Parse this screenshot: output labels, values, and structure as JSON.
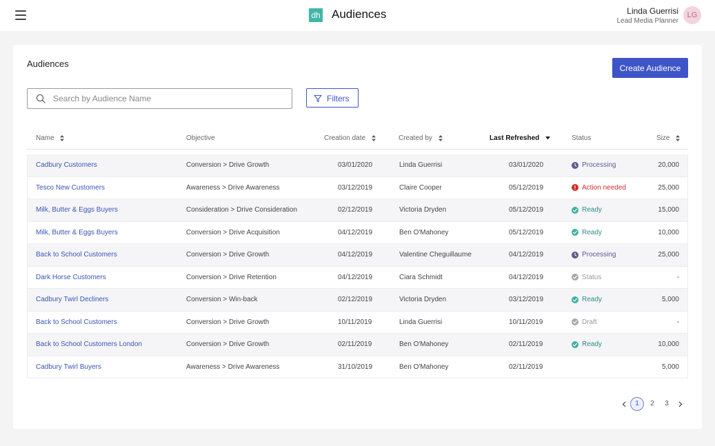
{
  "header": {
    "logo_text": "dh",
    "title": "Audiences",
    "user_name": "Linda Guerrisi",
    "user_role": "Lead Media Planner",
    "user_initials": "LG"
  },
  "page": {
    "title": "Audiences",
    "create_label": "Create Audience",
    "search_placeholder": "Search by Audience Name",
    "search_value": "",
    "filters_label": "Filters"
  },
  "table": {
    "columns": {
      "name": "Name",
      "objective": "Objective",
      "creation_date": "Creation date",
      "created_by": "Created by",
      "last_refreshed": "Last Refreshed",
      "status": "Status",
      "size": "Size"
    },
    "rows": [
      {
        "name": "Cadbury Customers",
        "objective": "Conversion > Drive Growth",
        "creation_date": "03/01/2020",
        "created_by": "Linda Guerrisi",
        "last_refreshed": "03/01/2020",
        "status": "Processing",
        "status_kind": "processing",
        "size": "20,000"
      },
      {
        "name": "Tesco New Customers",
        "objective": "Awareness > Drive Awareness",
        "creation_date": "03/12/2019",
        "created_by": "Claire Cooper",
        "last_refreshed": "05/12/2019",
        "status": "Action needed",
        "status_kind": "action",
        "size": "25,000"
      },
      {
        "name": "Milk, Butter & Eggs Buyers",
        "objective": "Consideration > Drive Consideration",
        "creation_date": "02/12/2019",
        "created_by": "Victoria Dryden",
        "last_refreshed": "05/12/2019",
        "status": "Ready",
        "status_kind": "ready",
        "size": "15,000"
      },
      {
        "name": "Milk, Butter & Eggs Buyers",
        "objective": "Conversion > Drive Acquisition",
        "creation_date": "04/12/2019",
        "created_by": "Ben O'Mahoney",
        "last_refreshed": "05/12/2019",
        "status": "Ready",
        "status_kind": "ready",
        "size": "10,000"
      },
      {
        "name": "Back to School Customers",
        "objective": "Conversion > Drive Growth",
        "creation_date": "04/12/2019",
        "created_by": "Valentine Cheguillaume",
        "last_refreshed": "04/12/2019",
        "status": "Processing",
        "status_kind": "processing",
        "size": "25,000"
      },
      {
        "name": "Dark Horse Customers",
        "objective": "Conversion > Drive Retention",
        "creation_date": "04/12/2019",
        "created_by": "Ciara Schmidt",
        "last_refreshed": "04/12/2019",
        "status": "Status",
        "status_kind": "neutral",
        "size": "-"
      },
      {
        "name": "Cadbury Twirl Decliners",
        "objective": "Conversion > Win-back",
        "creation_date": "02/12/2019",
        "created_by": "Victoria Dryden",
        "last_refreshed": "03/12/2019",
        "status": "Ready",
        "status_kind": "ready",
        "size": "5,000"
      },
      {
        "name": "Back to School Customers",
        "objective": "Conversion > Drive Growth",
        "creation_date": "10/11/2019",
        "created_by": "Linda Guerrisi",
        "last_refreshed": "10/11/2019",
        "status": "Draft",
        "status_kind": "neutral",
        "size": "-"
      },
      {
        "name": "Back to School Customers London",
        "objective": "Conversion > Drive Growth",
        "creation_date": "02/11/2019",
        "created_by": "Ben O'Mahoney",
        "last_refreshed": "02/11/2019",
        "status": "Ready",
        "status_kind": "ready",
        "size": "10,000"
      },
      {
        "name": "Cadbury Twirl Buyers",
        "objective": "Awareness > Drive Awareness",
        "creation_date": "31/10/2019",
        "created_by": "Ben O'Mahoney",
        "last_refreshed": "02/11/2019",
        "status": "",
        "status_kind": "none",
        "size": "5,000"
      }
    ]
  },
  "pagination": {
    "pages": [
      "1",
      "2",
      "3"
    ],
    "current": "1"
  },
  "colors": {
    "primary": "#3e55c7",
    "logo": "#41b6a6",
    "processing": "#5f5a8e",
    "action_needed": "#d42b2b",
    "ready": "#3fb0a3",
    "neutral": "#a8a8a8"
  },
  "icons": {
    "menu": "hamburger-icon",
    "search": "search-icon",
    "filter": "funnel-icon",
    "sort": "sort-arrows-icon",
    "sort_active": "caret-down-icon",
    "prev": "chevron-left-icon",
    "next": "chevron-right-icon"
  }
}
